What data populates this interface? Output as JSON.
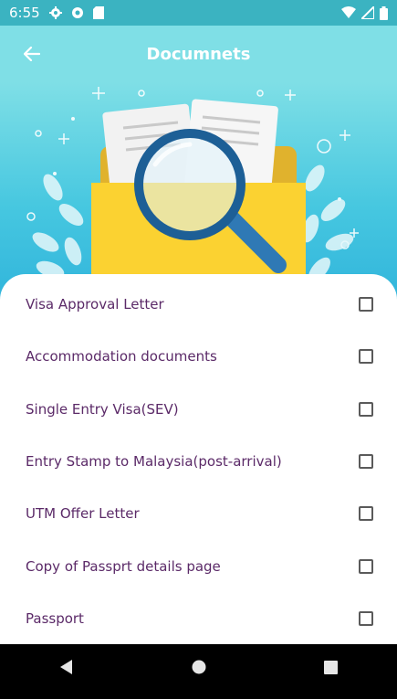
{
  "status_bar": {
    "time": "6:55",
    "icons_left": [
      "gear-icon",
      "circle-icon",
      "sd-card-icon"
    ],
    "icons_right": [
      "wifi-icon",
      "signal-icon",
      "battery-icon"
    ]
  },
  "app_bar": {
    "title": "Documnets",
    "back_icon": "arrow-left-icon",
    "background": "#7fdfe6"
  },
  "hero": {
    "illustration": "documents-folder-magnifier-illustration"
  },
  "documents": {
    "items": [
      {
        "label": "Visa Approval Letter",
        "checked": false
      },
      {
        "label": "Accommodation documents",
        "checked": false
      },
      {
        "label": "Single Entry Visa(SEV)",
        "checked": false
      },
      {
        "label": "Entry Stamp to Malaysia(post-arrival)",
        "checked": false
      },
      {
        "label": "UTM Offer Letter",
        "checked": false
      },
      {
        "label": "Copy of Passprt details page",
        "checked": false
      },
      {
        "label": "Passport",
        "checked": false
      }
    ]
  },
  "nav_bar": {
    "buttons": [
      "back-triangle-icon",
      "home-circle-icon",
      "recents-square-icon"
    ]
  },
  "colors": {
    "status_bar": "#3bb3c1",
    "label_text": "#5b2a68"
  }
}
